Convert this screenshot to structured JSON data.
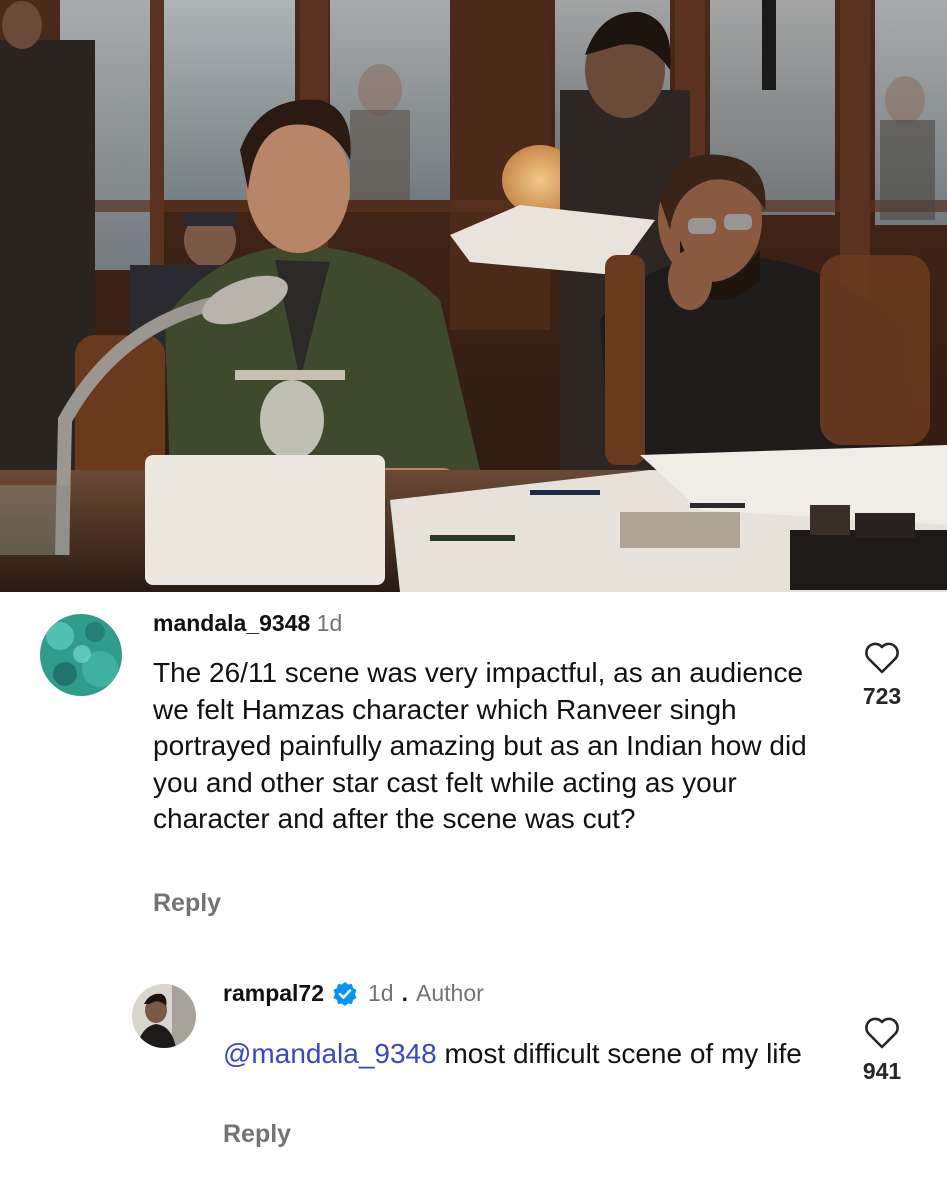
{
  "comments": [
    {
      "username": "mandala_9348",
      "time": "1d",
      "text": "The 26/11 scene was very impactful, as an audience we felt Hamzas character which Ranveer singh portrayed painfully amazing but as an Indian how did you and other star cast felt while acting as your character and after the scene was cut?",
      "reply_label": "Reply",
      "likes": "723",
      "like_icon": "heart-outline-icon"
    }
  ],
  "replies": [
    {
      "username": "rampal72",
      "verified": true,
      "time": "1d",
      "separator": ".",
      "author_label": "Author",
      "mention": "@mandala_9348",
      "text": " most difficult scene of my life",
      "reply_label": "Reply",
      "likes": "941",
      "like_icon": "heart-outline-icon"
    }
  ],
  "colors": {
    "mention": "#3a47c2",
    "verified_badge": "#0095f6",
    "secondary_text": "#737373"
  }
}
